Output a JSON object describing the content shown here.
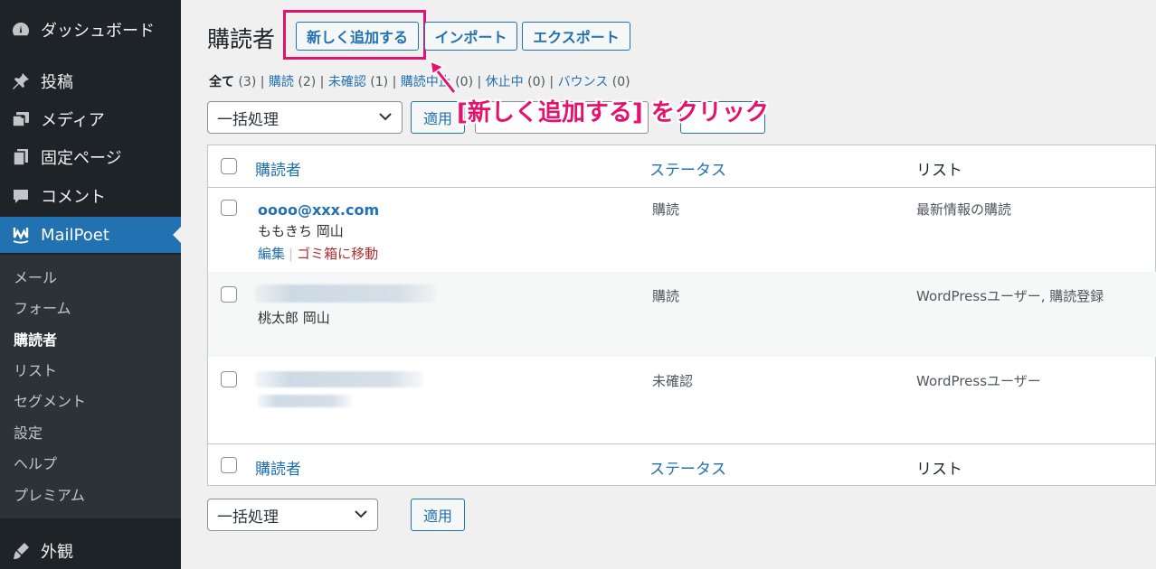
{
  "sidebar": {
    "menu": [
      {
        "label": "ダッシュボード",
        "icon": "dashboard-icon"
      },
      {
        "label": "投稿",
        "icon": "pin-icon"
      },
      {
        "label": "メディア",
        "icon": "media-icon"
      },
      {
        "label": "固定ページ",
        "icon": "page-icon"
      },
      {
        "label": "コメント",
        "icon": "comment-icon"
      },
      {
        "label": "MailPoet",
        "icon": "mailpoet-icon"
      }
    ],
    "submenu": [
      "メール",
      "フォーム",
      "購読者",
      "リスト",
      "セグメント",
      "設定",
      "ヘルプ",
      "プレミアム"
    ],
    "bottom_menu": {
      "label": "外観",
      "icon": "appearance-icon"
    }
  },
  "header": {
    "title": "購読者",
    "add_new": "新しく追加する",
    "import": "インポート",
    "export": "エクスポート"
  },
  "filters": [
    {
      "label": "全て",
      "count": "(3)"
    },
    {
      "label": "購読",
      "count": "(2)"
    },
    {
      "label": "未確認",
      "count": "(1)"
    },
    {
      "label": "購読中止",
      "count": "(0)"
    },
    {
      "label": "休止中",
      "count": "(0)"
    },
    {
      "label": "バウンス",
      "count": "(0)"
    }
  ],
  "bulk": {
    "select": "一括処理",
    "apply": "適用"
  },
  "annotation": "[新しく追加する] をクリック",
  "table": {
    "headers": {
      "subscriber": "購読者",
      "status": "ステータス",
      "lists": "リスト"
    },
    "rows": [
      {
        "email": "oooo@xxx.com",
        "name": "ももきち 岡山",
        "status": "購読",
        "lists": "最新情報の購読",
        "edit": "編集",
        "trash": "ゴミ箱に移動"
      },
      {
        "email": "",
        "name": "桃太郎 岡山",
        "status": "購読",
        "lists": "WordPressユーザー, 購読登録"
      },
      {
        "email": "",
        "name": "",
        "status": "未確認",
        "lists": "WordPressユーザー"
      }
    ]
  },
  "colors": {
    "accent": "#2271b1",
    "sidebar_bg": "#1d2327",
    "highlight": "#e5126d",
    "trash": "#b32d2e"
  }
}
